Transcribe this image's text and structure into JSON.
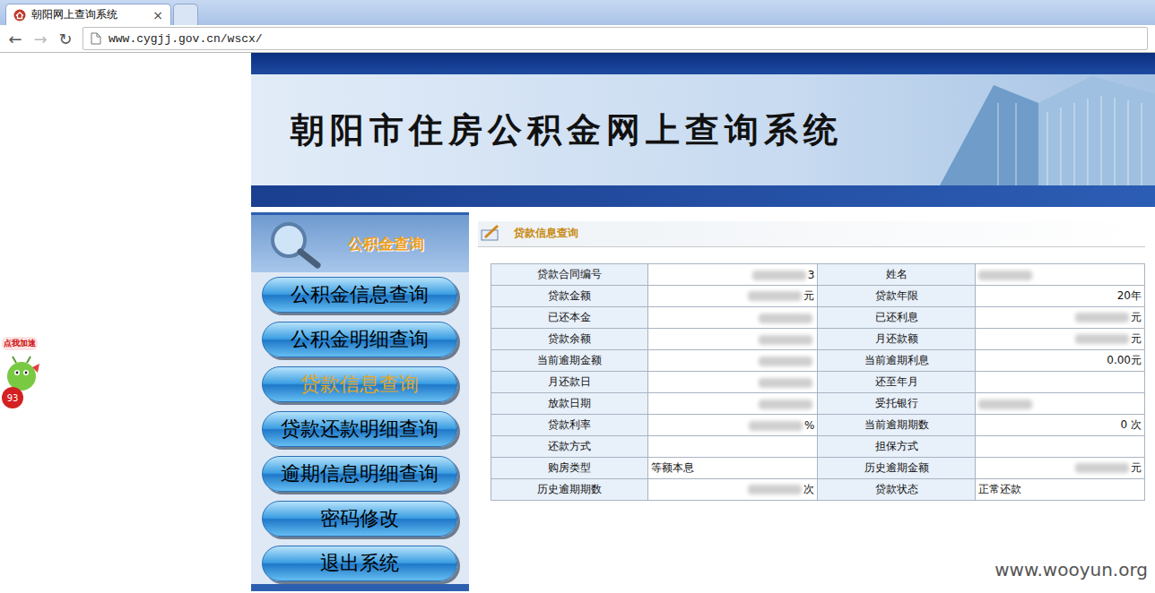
{
  "browser": {
    "tabs": [
      {
        "label": "朝阳网上查询系统",
        "close": "×",
        "selected": true
      },
      {
        "label": "",
        "close": "",
        "selected": false
      }
    ],
    "nav": [
      "←",
      "→",
      "↻"
    ],
    "address": "www.cygjj.gov.cn/wscx/"
  },
  "banner": {
    "title": "朝阳市住房公积金网上查询系统"
  },
  "sidebar": {
    "header": "公积金查询",
    "items": [
      {
        "label": "公积金信息查询",
        "selected": false
      },
      {
        "label": "公积金明细查询",
        "selected": false
      },
      {
        "label": "贷款信息查询",
        "selected": true
      },
      {
        "label": "贷款还款明细查询",
        "selected": false
      },
      {
        "label": "逾期信息明细查询",
        "selected": false
      },
      {
        "label": "密码修改",
        "selected": false
      },
      {
        "label": "退出系统",
        "selected": false
      }
    ]
  },
  "section": {
    "title": "贷款信息查询"
  },
  "table": {
    "rows": [
      [
        {
          "label": "贷款合同编号",
          "value": "3",
          "masked": true,
          "kind": "amount"
        },
        {
          "label": "姓名",
          "value": "",
          "masked": true,
          "kind": "text"
        }
      ],
      [
        {
          "label": "贷款金额",
          "value": "元",
          "masked": true,
          "kind": "amount"
        },
        {
          "label": "贷款年限",
          "value": "20年",
          "masked": false,
          "kind": "amount"
        }
      ],
      [
        {
          "label": "已还本金",
          "value": "",
          "masked": true,
          "kind": "amount"
        },
        {
          "label": "已还利息",
          "value": "元",
          "masked": true,
          "kind": "amount"
        }
      ],
      [
        {
          "label": "贷款余额",
          "value": "",
          "masked": true,
          "kind": "amount"
        },
        {
          "label": "月还款额",
          "value": "元",
          "masked": true,
          "kind": "amount"
        }
      ],
      [
        {
          "label": "当前逾期金额",
          "value": "",
          "masked": true,
          "kind": "amount"
        },
        {
          "label": "当前逾期利息",
          "value": "0.00元",
          "masked": false,
          "kind": "amount"
        }
      ],
      [
        {
          "label": "月还款日",
          "value": "",
          "masked": true,
          "kind": "amount"
        },
        {
          "label": "还至年月",
          "value": "",
          "masked": false,
          "kind": "amount"
        }
      ],
      [
        {
          "label": "放款日期",
          "value": "",
          "masked": true,
          "kind": "amount"
        },
        {
          "label": "受托银行",
          "value": "",
          "masked": true,
          "kind": "text"
        }
      ],
      [
        {
          "label": "贷款利率",
          "value": "%",
          "masked": true,
          "kind": "amount"
        },
        {
          "label": "当前逾期期数",
          "value": "0 次",
          "masked": false,
          "kind": "amount"
        }
      ],
      [
        {
          "label": "还款方式",
          "value": "",
          "masked": false,
          "kind": "text"
        },
        {
          "label": "担保方式",
          "value": "",
          "masked": false,
          "kind": "text"
        }
      ],
      [
        {
          "label": "购房类型",
          "value": "等额本息",
          "masked": false,
          "kind": "text"
        },
        {
          "label": "历史逾期金额",
          "value": "元",
          "masked": true,
          "kind": "amount"
        }
      ],
      [
        {
          "label": "历史逾期期数",
          "value": "次",
          "masked": true,
          "kind": "amount"
        },
        {
          "label": "贷款状态",
          "value": "正常还款",
          "masked": false,
          "kind": "text"
        }
      ]
    ]
  },
  "widget": {
    "badge": "点我加速",
    "count": "93"
  },
  "watermark": "www.wooyun.org"
}
